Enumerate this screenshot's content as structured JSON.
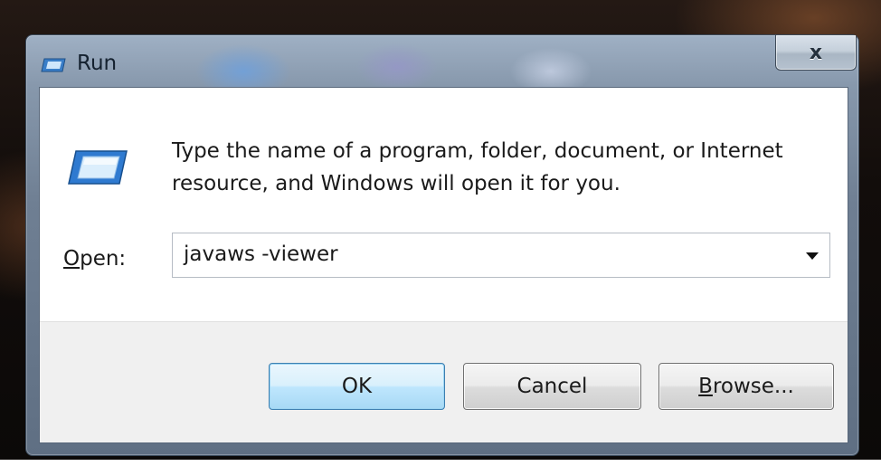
{
  "window": {
    "title": "Run",
    "close_symbol": "x",
    "title_icon": "run-icon"
  },
  "dialog": {
    "icon": "run-icon",
    "prompt": "Type the name of a program, folder, document, or Internet resource, and Windows will open it for you.",
    "open_label_accel": "O",
    "open_label_rest": "pen:",
    "open_value": "javaws -viewer"
  },
  "buttons": {
    "ok": "OK",
    "cancel": "Cancel",
    "browse_accel": "B",
    "browse_rest": "rowse..."
  },
  "colors": {
    "ok_border": "#3c7fb1",
    "ok_fill": "#bee6fd",
    "title_text": "#14212f"
  }
}
